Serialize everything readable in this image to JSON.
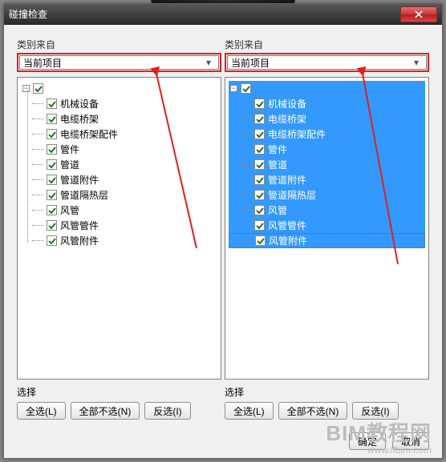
{
  "window": {
    "title": "碰撞检查"
  },
  "panel": {
    "source_label": "类别来自",
    "combo_value": "当前项目",
    "select_label": "选择",
    "btn_all": "全选(L)",
    "btn_none": "全部不选(N)",
    "btn_invert": "反选(I)"
  },
  "categories": [
    "机械设备",
    "电缆桥架",
    "电缆桥架配件",
    "管件",
    "管道",
    "管道附件",
    "管道隔热层",
    "风管",
    "风管管件",
    "风管附件"
  ],
  "footer": {
    "ok": "确定",
    "cancel": "取消"
  },
  "watermark": {
    "line1": "BIM教程网",
    "line2": "www.ifbim.com"
  }
}
